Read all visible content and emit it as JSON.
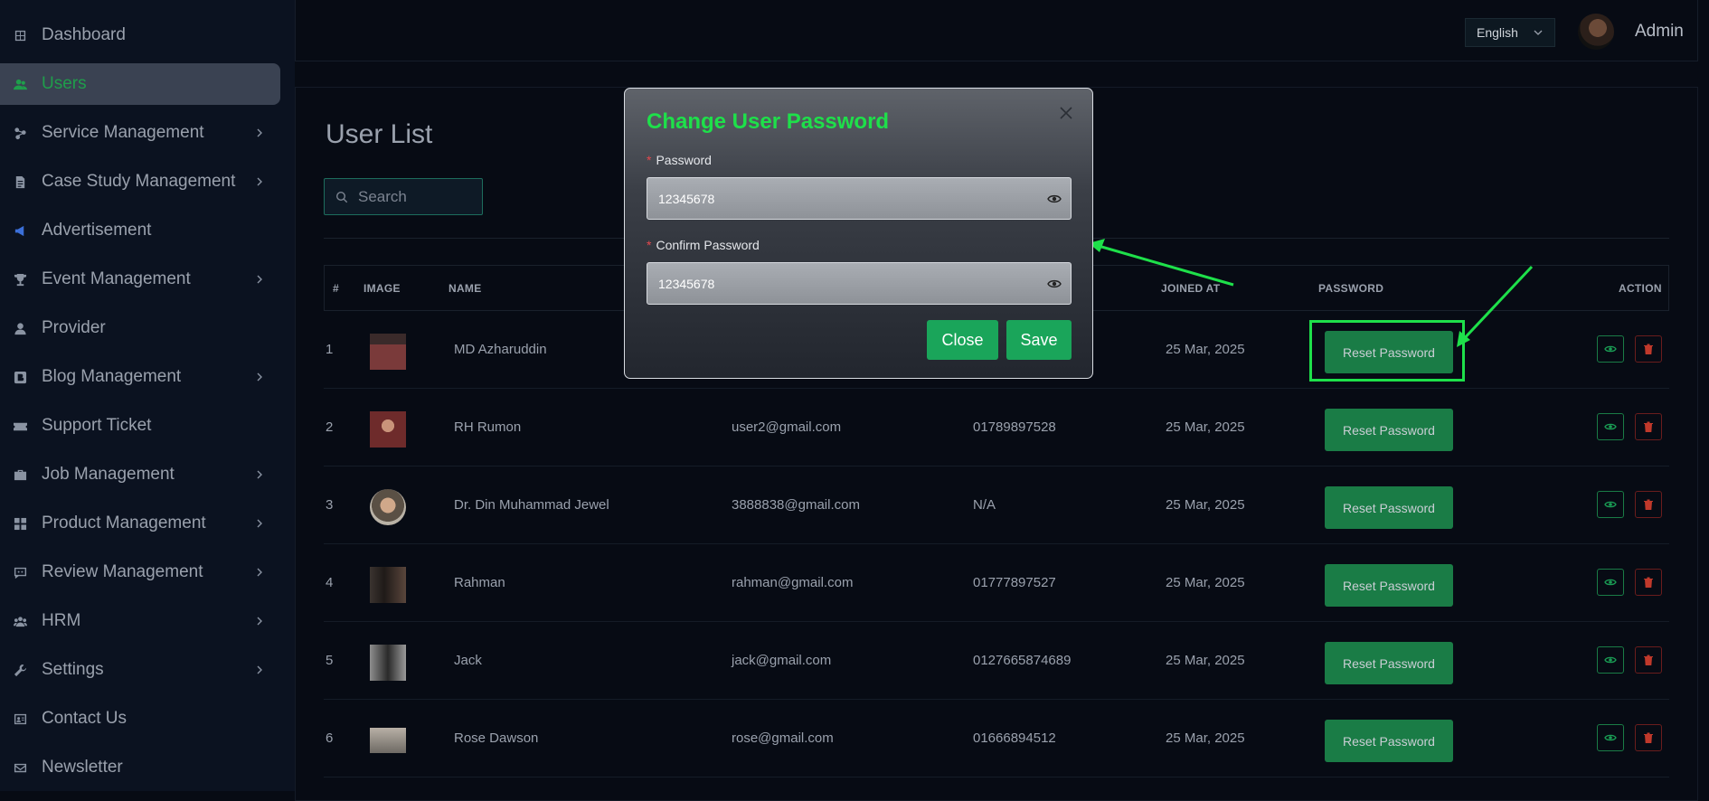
{
  "sidebar": {
    "items": [
      {
        "label": "Dashboard",
        "icon": "dashboard-icon"
      },
      {
        "label": "Users",
        "icon": "users-icon",
        "active": true
      },
      {
        "label": "Service Management",
        "icon": "service-icon",
        "submenu": true
      },
      {
        "label": "Case Study Management",
        "icon": "document-icon",
        "submenu": true
      },
      {
        "label": "Advertisement",
        "icon": "megaphone-icon"
      },
      {
        "label": "Event Management",
        "icon": "trophy-icon",
        "submenu": true
      },
      {
        "label": "Provider",
        "icon": "user-icon"
      },
      {
        "label": "Blog Management",
        "icon": "blog-icon",
        "submenu": true
      },
      {
        "label": "Support Ticket",
        "icon": "ticket-icon"
      },
      {
        "label": "Job Management",
        "icon": "briefcase-icon",
        "submenu": true
      },
      {
        "label": "Product Management",
        "icon": "grid-icon",
        "submenu": true
      },
      {
        "label": "Review Management",
        "icon": "review-icon",
        "submenu": true
      },
      {
        "label": "HRM",
        "icon": "team-icon",
        "submenu": true
      },
      {
        "label": "Settings",
        "icon": "wrench-icon",
        "submenu": true
      },
      {
        "label": "Contact Us",
        "icon": "contact-icon"
      },
      {
        "label": "Newsletter",
        "icon": "mail-icon"
      }
    ]
  },
  "header": {
    "language": "English",
    "user_name": "Admin"
  },
  "main": {
    "title": "User List",
    "search_placeholder": "Search",
    "columns": {
      "index": "#",
      "image": "IMAGE",
      "name": "NAME",
      "joined": "JOINED AT",
      "password": "PASSWORD",
      "action": "ACTION"
    },
    "reset_label": "Reset Password",
    "rows": [
      {
        "index": "1",
        "name": "MD Azharuddin",
        "email": "",
        "phone": "",
        "joined": "25 Mar, 2025"
      },
      {
        "index": "2",
        "name": "RH Rumon",
        "email": "user2@gmail.com",
        "phone": "01789897528",
        "joined": "25 Mar, 2025"
      },
      {
        "index": "3",
        "name": "Dr. Din Muhammad Jewel",
        "email": "3888838@gmail.com",
        "phone": "N/A",
        "joined": "25 Mar, 2025"
      },
      {
        "index": "4",
        "name": "Rahman",
        "email": "rahman@gmail.com",
        "phone": "01777897527",
        "joined": "25 Mar, 2025"
      },
      {
        "index": "5",
        "name": "Jack",
        "email": "jack@gmail.com",
        "phone": "0127665874689",
        "joined": "25 Mar, 2025"
      },
      {
        "index": "6",
        "name": "Rose Dawson",
        "email": "rose@gmail.com",
        "phone": "01666894512",
        "joined": "25 Mar, 2025"
      }
    ]
  },
  "modal": {
    "title": "Change User Password",
    "password_label": "Password",
    "password_value": "12345678",
    "confirm_label": "Confirm Password",
    "confirm_value": "12345678",
    "close_label": "Close",
    "save_label": "Save"
  },
  "colors": {
    "accent_green": "#1aa55a",
    "highlight_green": "#1ee04a",
    "background": "#070b14"
  }
}
